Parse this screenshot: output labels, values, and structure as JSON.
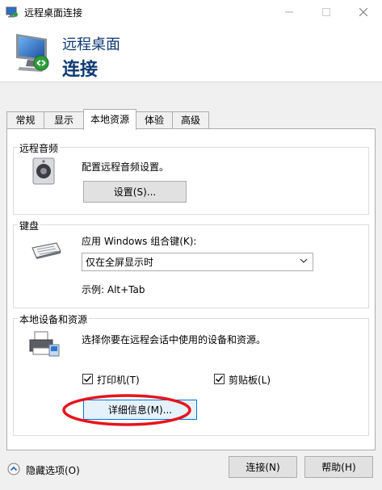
{
  "window": {
    "title": "远程桌面连接"
  },
  "banner": {
    "line1": "远程桌面",
    "line2": "连接"
  },
  "tabs": [
    {
      "label": "常规"
    },
    {
      "label": "显示"
    },
    {
      "label": "本地资源"
    },
    {
      "label": "体验"
    },
    {
      "label": "高级"
    }
  ],
  "audio": {
    "title": "远程音频",
    "description": "配置远程音频设置。",
    "settings_button": "设置(S)..."
  },
  "keyboard": {
    "title": "键盘",
    "label": "应用 Windows 组合键(K):",
    "selected_option": "仅在全屏显示时",
    "example": "示例: Alt+Tab"
  },
  "devices": {
    "title": "本地设备和资源",
    "description": "选择你要在远程会话中使用的设备和资源。",
    "printers_label": "打印机(T)",
    "printers_checked": true,
    "clipboard_label": "剪贴板(L)",
    "clipboard_checked": true,
    "more_button": "详细信息(M)..."
  },
  "footer": {
    "hide_options": "隐藏选项(O)",
    "connect_button": "连接(N)",
    "help_button": "帮助(H)"
  },
  "colors": {
    "accent": "#0078d7",
    "banner_text": "#0f3a75",
    "annotation": "#e8141c"
  }
}
